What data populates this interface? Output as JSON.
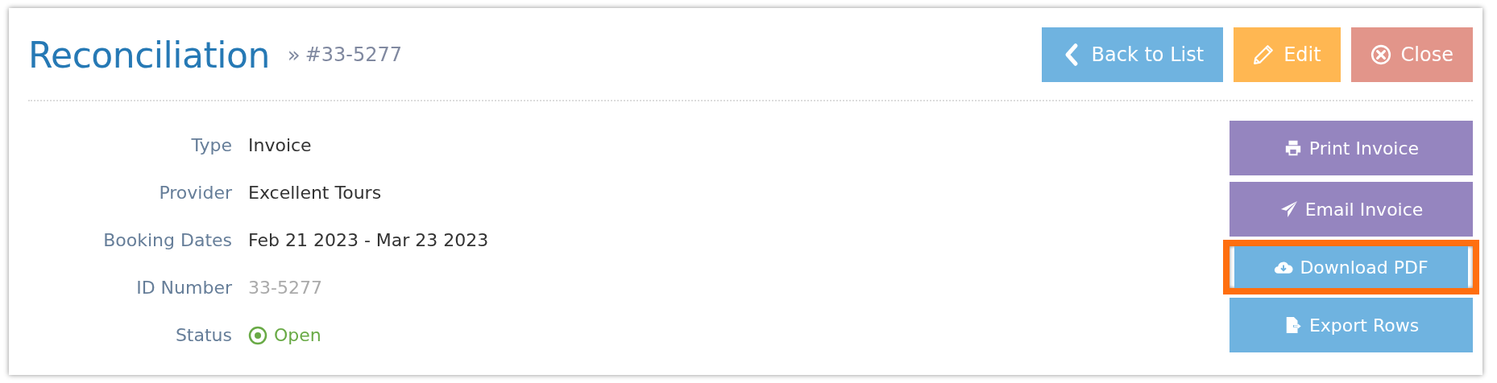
{
  "header": {
    "title": "Reconciliation",
    "breadcrumb_sep": "»",
    "record": "#33-5277"
  },
  "header_buttons": [
    {
      "label": "Back to List",
      "kind": "info"
    },
    {
      "label": "Edit",
      "kind": "warning"
    },
    {
      "label": "Close",
      "kind": "danger"
    }
  ],
  "fields": [
    {
      "label": "Type",
      "value": "Invoice",
      "kind": "text"
    },
    {
      "label": "Provider",
      "value": "Excellent Tours",
      "kind": "text"
    },
    {
      "label": "Booking Dates",
      "value": "Feb 21 2023 - Mar 23 2023",
      "kind": "text"
    },
    {
      "label": "ID Number",
      "value": "33-5277",
      "kind": "muted"
    },
    {
      "label": "Status",
      "value": "Open",
      "kind": "status"
    }
  ],
  "actions": [
    {
      "label": "Print Invoice",
      "kind": "primary",
      "highlighted": false
    },
    {
      "label": "Email Invoice",
      "kind": "primary",
      "highlighted": false
    },
    {
      "label": "Download PDF",
      "kind": "info",
      "highlighted": true
    },
    {
      "label": "Export Rows",
      "kind": "info",
      "highlighted": false
    }
  ]
}
